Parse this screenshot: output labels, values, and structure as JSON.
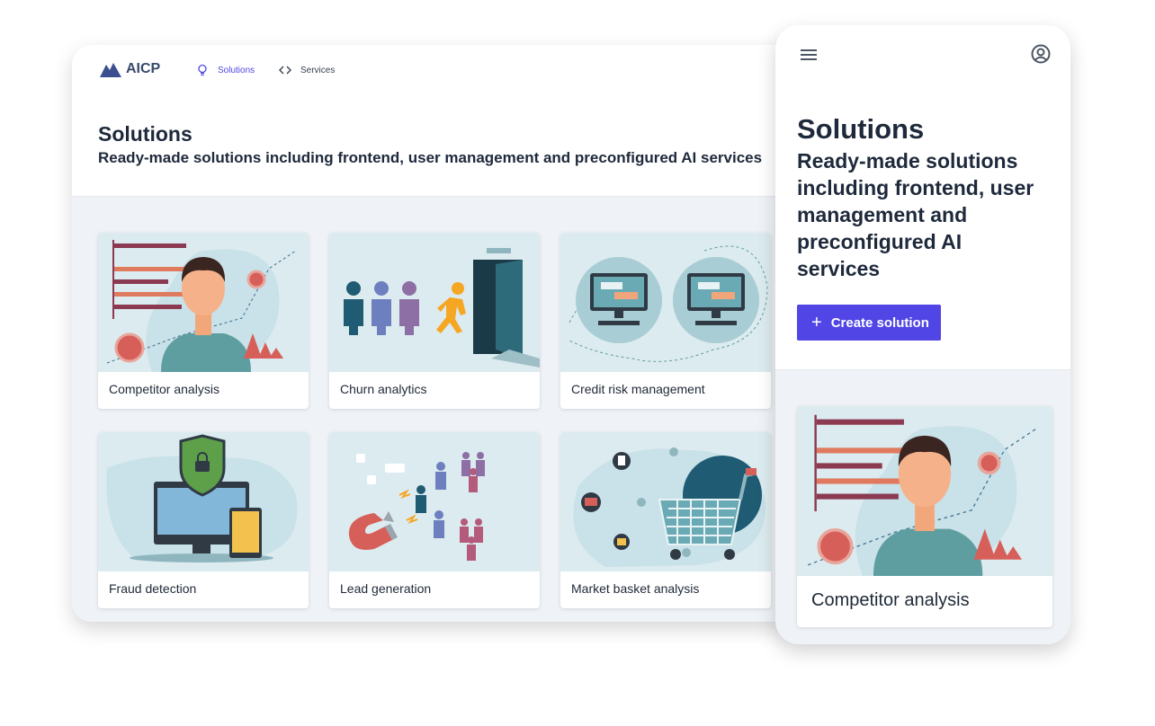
{
  "desktop": {
    "logo_text": "AICP",
    "nav": [
      {
        "label": "Solutions",
        "icon": "lightbulb-icon",
        "active": true
      },
      {
        "label": "Services",
        "icon": "code-icon",
        "active": false
      }
    ],
    "title": "Solutions",
    "subtitle": "Ready-made solutions including frontend, user management and preconfigured AI services",
    "cards": [
      {
        "label": "Competitor analysis",
        "illustration": "person-with-bar-chart-illustration"
      },
      {
        "label": "Churn analytics",
        "illustration": "people-leaving-door-illustration"
      },
      {
        "label": "Credit risk management",
        "illustration": "computer-monitors-illustration"
      },
      {
        "label": "Fraud detection",
        "illustration": "shield-lock-monitor-illustration"
      },
      {
        "label": "Lead generation",
        "illustration": "magnet-attracting-people-illustration"
      },
      {
        "label": "Market basket analysis",
        "illustration": "shopping-cart-illustration"
      }
    ]
  },
  "mobile": {
    "menu_icon": "hamburger-icon",
    "user_icon": "user-circle-icon",
    "title": "Solutions",
    "subtitle": "Ready-made solutions including frontend, user management and preconfigured AI services",
    "create_button": "Create solution",
    "card_label": "Competitor analysis"
  },
  "colors": {
    "accent": "#5146e5",
    "page_bg": "#eff3f7",
    "illustration_bg": "#dcebef"
  }
}
